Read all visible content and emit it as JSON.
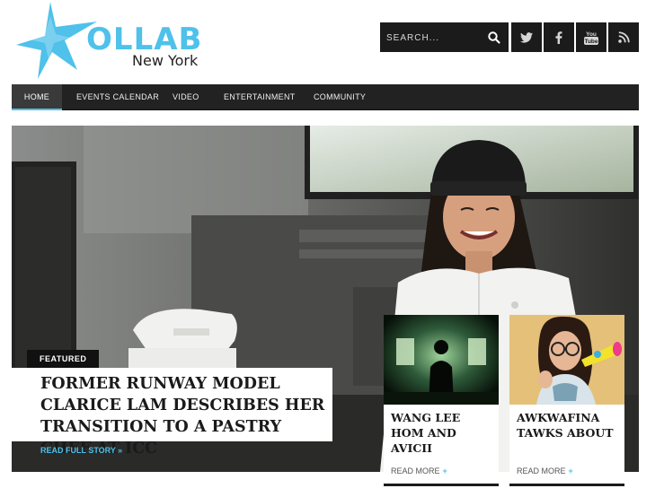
{
  "site": {
    "logo_word": "OLLAB",
    "logo_sub": "New York",
    "accent_color": "#4fc1ea"
  },
  "search": {
    "placeholder": "SEARCH..."
  },
  "social": [
    {
      "icon": "twitter-icon"
    },
    {
      "icon": "facebook-icon"
    },
    {
      "icon": "youtube-icon",
      "label": "You Tube"
    },
    {
      "icon": "rss-icon"
    }
  ],
  "nav": {
    "items": [
      {
        "label": "HOME",
        "active": true
      },
      {
        "label": "EVENTS CALENDAR"
      },
      {
        "label": "VIDEO"
      },
      {
        "label": "ENTERTAINMENT"
      },
      {
        "label": "COMMUNITY"
      }
    ]
  },
  "hero": {
    "tag": "FEATURED",
    "headline": "FORMER RUNWAY MODEL CLARICE LAM DESCRIBES HER TRANSITION TO A PASTRY CHEF AT ICC",
    "read_more": "READ FULL STORY »"
  },
  "cards": [
    {
      "title": "WANG LEE HOM AND AVICII",
      "read_more": "READ MORE",
      "plus": "+"
    },
    {
      "title": "AWKWAFINA TAWKS ABOUT",
      "read_more": "READ MORE",
      "plus": "+"
    }
  ]
}
